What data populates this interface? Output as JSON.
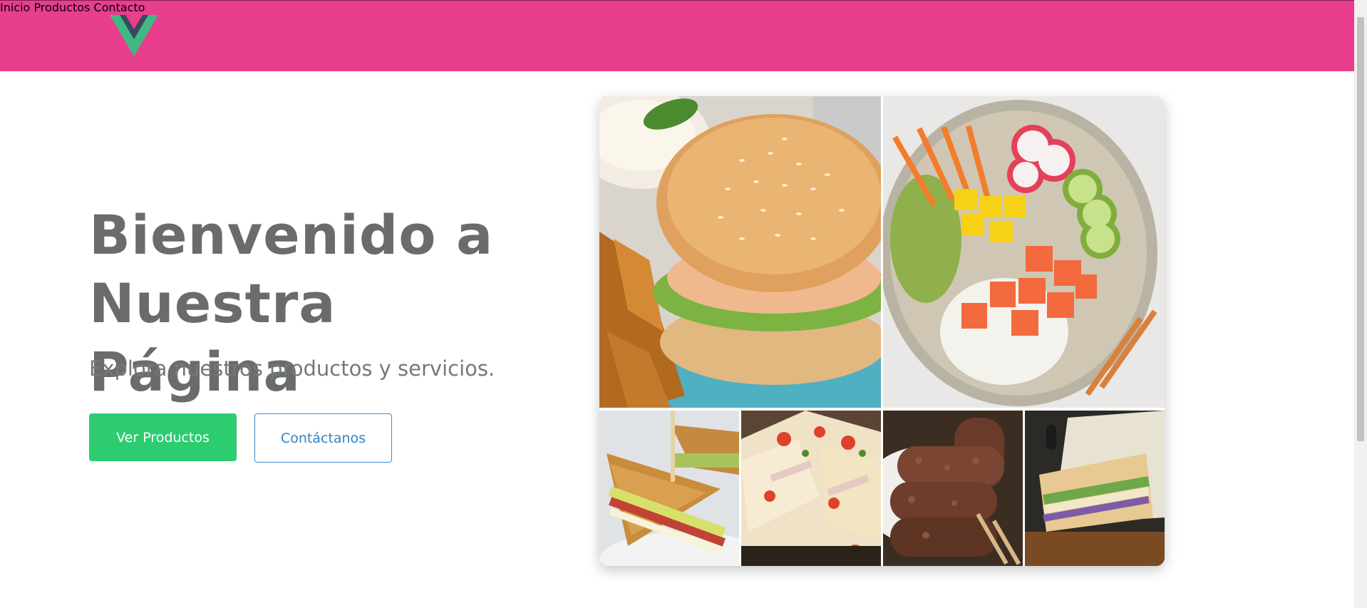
{
  "header": {
    "logo_icon": "vue-logo-icon",
    "bg_color": "#e83e8c",
    "nav": [
      {
        "label": "Inicio"
      },
      {
        "label": "Productos"
      },
      {
        "label": "Contacto"
      }
    ]
  },
  "hero": {
    "title_line1": "Bienvenido a",
    "title_line2": "Nuestra Página",
    "subtitle": "Explora nuestros productos y servicios.",
    "primary_button": "Ver Productos",
    "secondary_button": "Contáctanos",
    "primary_color": "#2ecc71",
    "secondary_color": "#2d84c9"
  },
  "gallery": {
    "images": [
      "burger-image",
      "poke-bowl-image",
      "club-sandwich-image",
      "quesadilla-image",
      "kebab-meat-image",
      "wrapped-sandwich-image"
    ]
  }
}
